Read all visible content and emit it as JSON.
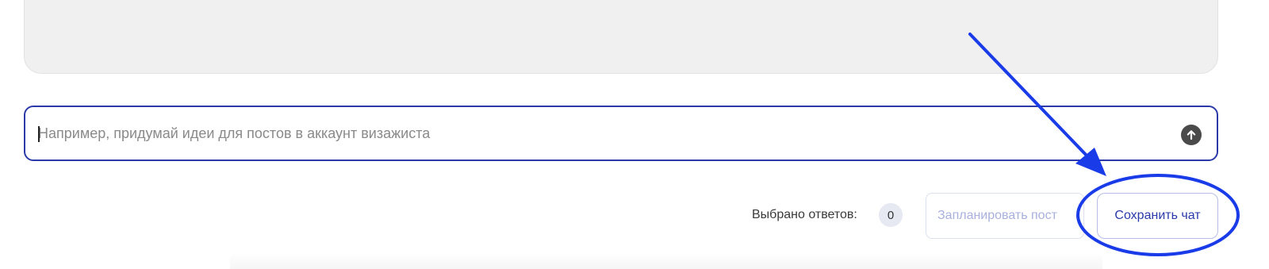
{
  "chat": {
    "prompt": {
      "placeholder": "Например, придумай идеи для постов в аккаунт визажиста",
      "value": ""
    },
    "send_icon": "arrow-up-circle-icon"
  },
  "footer": {
    "selected_label": "Выбрано ответов:",
    "selected_count": "0",
    "schedule_label": "Запланировать пост",
    "save_label": "Сохранить чат"
  },
  "annotation": {
    "color": "#1a3be8",
    "arrow_icon": "arrow-annotation",
    "highlight": "ellipse-highlight"
  }
}
